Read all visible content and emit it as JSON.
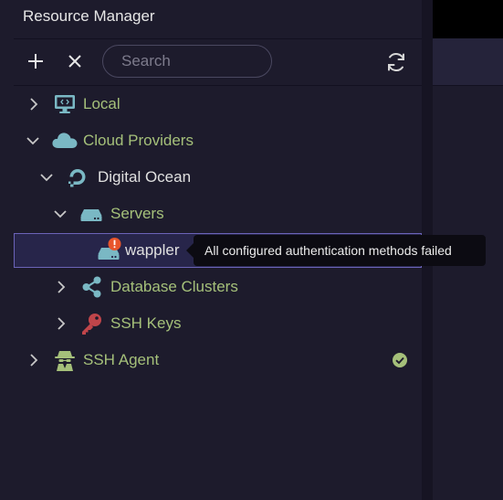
{
  "panel": {
    "title": "Resource Manager"
  },
  "toolbar": {
    "add_icon": "plus-icon",
    "close_icon": "close-icon",
    "refresh_icon": "refresh-icon",
    "search_placeholder": "Search",
    "search_value": ""
  },
  "tree": {
    "local": {
      "label": "Local",
      "icon": "monitor-icon",
      "expanded": false
    },
    "cloud": {
      "label": "Cloud Providers",
      "icon": "cloud-icon",
      "expanded": true
    },
    "digital_ocean": {
      "label": "Digital Ocean",
      "icon": "digitalocean-icon",
      "expanded": true
    },
    "servers": {
      "label": "Servers",
      "icon": "server-icon",
      "expanded": true
    },
    "wappler": {
      "label": "wappler",
      "icon": "server-error-icon",
      "status": "error"
    },
    "db_clusters": {
      "label": "Database Clusters",
      "icon": "share-nodes-icon",
      "expanded": false
    },
    "ssh_keys": {
      "label": "SSH Keys",
      "icon": "key-icon",
      "expanded": false
    },
    "ssh_agent": {
      "label": "SSH Agent",
      "icon": "spy-agent-icon",
      "expanded": false,
      "status": "ok"
    }
  },
  "tooltip": {
    "text": "All configured authentication methods failed"
  },
  "colors": {
    "background": "#1d1b2c",
    "label_green": "#a5c07a",
    "accent_selection": "#6b63b8",
    "error": "#e8552b",
    "ok": "#a5c07a",
    "key_red": "#c0454a",
    "icon_teal": "#7ab8c4"
  }
}
